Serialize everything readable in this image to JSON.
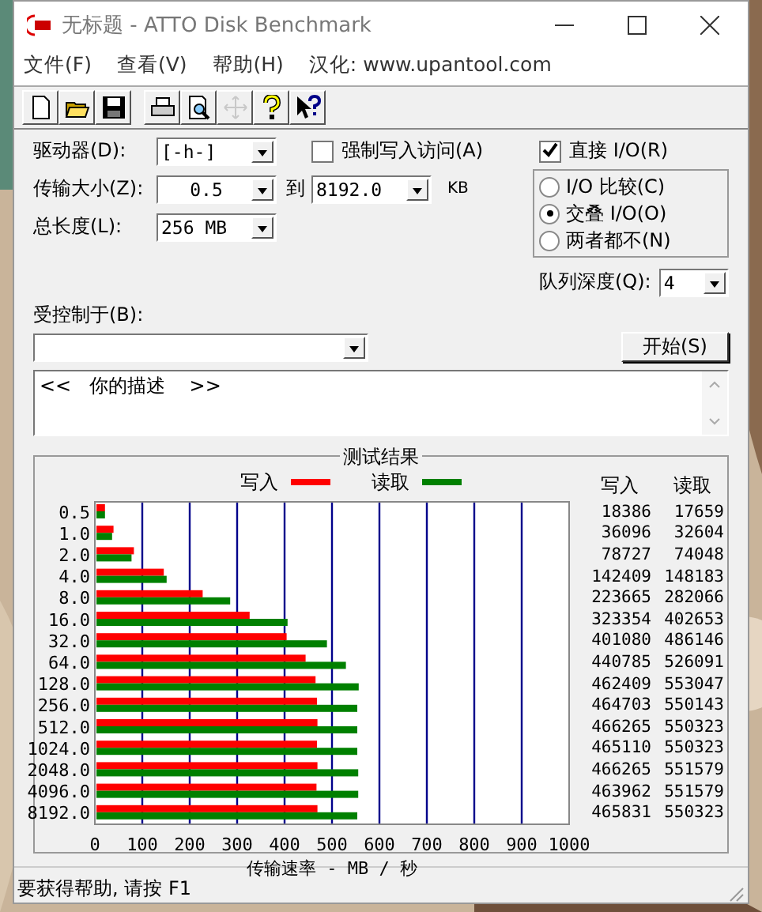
{
  "window": {
    "title": "无标题 - ATTO Disk Benchmark"
  },
  "menu": [
    {
      "label": "文件(F)"
    },
    {
      "label": "查看(V)"
    },
    {
      "label": "帮助(H)"
    },
    {
      "label": "汉化: www.upantool.com"
    }
  ],
  "toolbar": [
    {
      "kind": "new",
      "disabled": false
    },
    {
      "kind": "open",
      "disabled": false
    },
    {
      "kind": "save",
      "disabled": false
    },
    {
      "kind": "print",
      "disabled": false
    },
    {
      "kind": "preview",
      "disabled": false
    },
    {
      "kind": "move",
      "disabled": true
    },
    {
      "kind": "help",
      "disabled": false
    },
    {
      "kind": "context-help",
      "disabled": false
    }
  ],
  "form": {
    "drive": {
      "label": "驱动器(D):",
      "value": "[-h-]"
    },
    "transfer_size": {
      "label": "传输大小(Z):",
      "from": "0.5",
      "to_label": "到",
      "to": "8192.0",
      "unit": "KB"
    },
    "total_length": {
      "label": "总长度(L):",
      "value": "256 MB"
    },
    "force_write": {
      "label": "强制写入访问(A)",
      "checked": false
    },
    "direct_io": {
      "label": "直接 I/O(R)",
      "checked": true
    },
    "io_modes": [
      {
        "label": "I/O 比较(C)",
        "selected": false
      },
      {
        "label": "交叠 I/O(O)",
        "selected": true
      },
      {
        "label": "两者都不(N)",
        "selected": false
      }
    ],
    "queue_depth": {
      "label": "队列深度(Q):",
      "value": "4"
    },
    "controlled_by": {
      "label": "受控制于(B):"
    },
    "start_button": "开始(S)",
    "description": "<<   你的描述    >>"
  },
  "results": {
    "title": "测试结果",
    "columns": [
      "写入",
      "读取"
    ],
    "rows": [
      {
        "write": "18386",
        "read": "17659"
      },
      {
        "write": "36096",
        "read": "32604"
      },
      {
        "write": "78727",
        "read": "74048"
      },
      {
        "write": "142409",
        "read": "148183"
      },
      {
        "write": "223665",
        "read": "282066"
      },
      {
        "write": "323354",
        "read": "402653"
      },
      {
        "write": "401080",
        "read": "486146"
      },
      {
        "write": "440785",
        "read": "526091"
      },
      {
        "write": "462409",
        "read": "553047"
      },
      {
        "write": "464703",
        "read": "550143"
      },
      {
        "write": "466265",
        "read": "550323"
      },
      {
        "write": "465110",
        "read": "550323"
      },
      {
        "write": "466265",
        "read": "551579"
      },
      {
        "write": "463962",
        "read": "551579"
      },
      {
        "write": "465831",
        "read": "550323"
      }
    ],
    "chart_data": {
      "type": "bar",
      "orientation": "horizontal",
      "xlabel": "传输速率 - MB / 秒",
      "categories": [
        "0.5",
        "1.0",
        "2.0",
        "4.0",
        "8.0",
        "16.0",
        "32.0",
        "64.0",
        "128.0",
        "256.0",
        "512.0",
        "1024.0",
        "2048.0",
        "4096.0",
        "8192.0"
      ],
      "series": [
        {
          "name": "写入",
          "color": "#ff0000",
          "values": [
            18,
            36,
            79,
            142,
            224,
            323,
            401,
            441,
            462,
            465,
            466,
            465,
            466,
            464,
            466
          ]
        },
        {
          "name": "读取",
          "color": "#008000",
          "values": [
            18,
            33,
            74,
            148,
            282,
            403,
            486,
            526,
            553,
            550,
            550,
            550,
            552,
            552,
            550
          ]
        }
      ],
      "grid": true,
      "xlim": [
        0,
        1000
      ],
      "xticks": [
        0,
        100,
        200,
        300,
        400,
        500,
        600,
        700,
        800,
        900,
        1000
      ]
    }
  },
  "status_bar": "要获得帮助, 请按 F1"
}
